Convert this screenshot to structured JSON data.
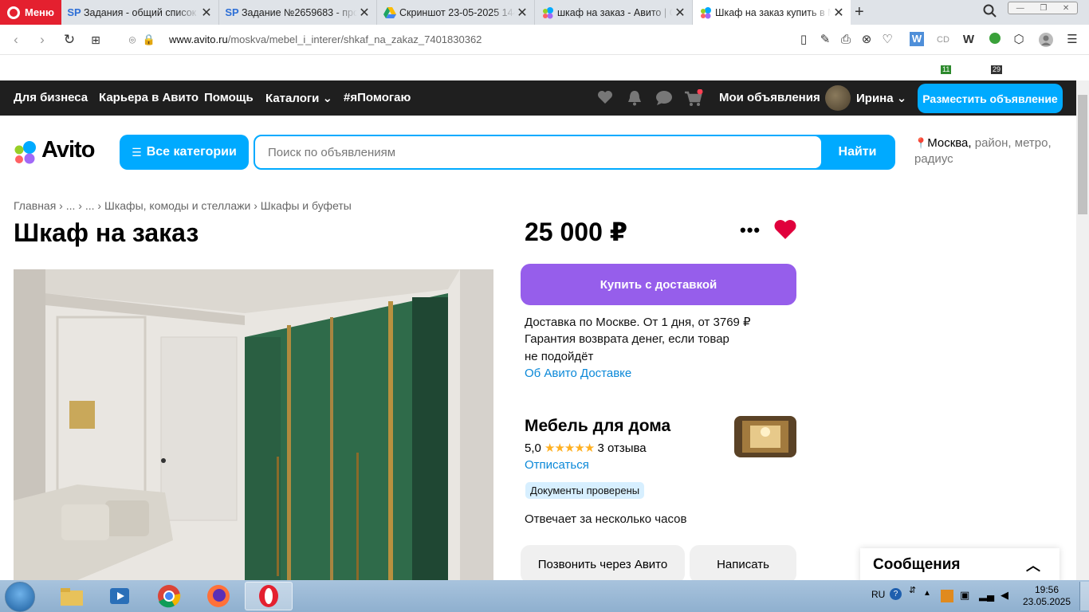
{
  "browser": {
    "menu_label": "Меню",
    "tabs": [
      {
        "title": "Задания - общий список з",
        "icon": "SP"
      },
      {
        "title": "Задание №2659683 - про",
        "icon": "SP"
      },
      {
        "title": "Скриншот 23-05-2025 144",
        "icon": "drive"
      },
      {
        "title": "шкаф на заказ - Авито | О",
        "icon": "avito"
      },
      {
        "title": "Шкаф на заказ купить в М",
        "icon": "avito"
      }
    ],
    "url_domain": "www.avito.ru",
    "url_path": "/moskva/mebel_i_interer/shkaf_na_zakaz_7401830362",
    "badge_counts": [
      "11",
      "29"
    ]
  },
  "topnav": {
    "items": [
      "Для бизнеса",
      "Карьера в Авито",
      "Помощь",
      "Каталоги",
      "#яПомогаю"
    ],
    "my_ads": "Мои объявления",
    "user_name": "Ирина",
    "post_button": "Разместить объявление"
  },
  "header": {
    "logo": "Avito",
    "categories_button": "Все категории",
    "search_placeholder": "Поиск по объявлениям",
    "find_button": "Найти",
    "location_city": "Москва,",
    "location_rest": " район, метро, радиус"
  },
  "breadcrumbs": [
    "Главная",
    "...",
    "...",
    "Шкафы, комоды и стеллажи",
    "Шкафы и буфеты"
  ],
  "listing": {
    "title": "Шкаф на заказ",
    "price": "25 000 ₽",
    "buy_button": "Купить с доставкой",
    "delivery_line1": "Доставка по Москве. От 1 дня, от 3769 ₽",
    "delivery_line2": "Гарантия возврата денег, если товар",
    "delivery_line3": "не подойдёт",
    "delivery_link": "Об Авито Доставке"
  },
  "seller": {
    "name": "Мебель для дома",
    "rating": "5,0",
    "stars": "★★★★★",
    "reviews": "3 отзыва",
    "unsubscribe": "Отписаться",
    "badge": "Документы проверены",
    "response": "Отвечает за несколько часов",
    "call_button": "Позвонить через Авито",
    "write_button": "Написать"
  },
  "messages_panel": {
    "title": "Сообщения"
  },
  "taskbar": {
    "lang": "RU",
    "time": "19:56",
    "date": "23.05.2025"
  },
  "colors": {
    "avito_blue": "#00aaff",
    "buy_purple": "#965eeb",
    "opera_red": "#e4202f",
    "heart_red": "#e0003c"
  }
}
